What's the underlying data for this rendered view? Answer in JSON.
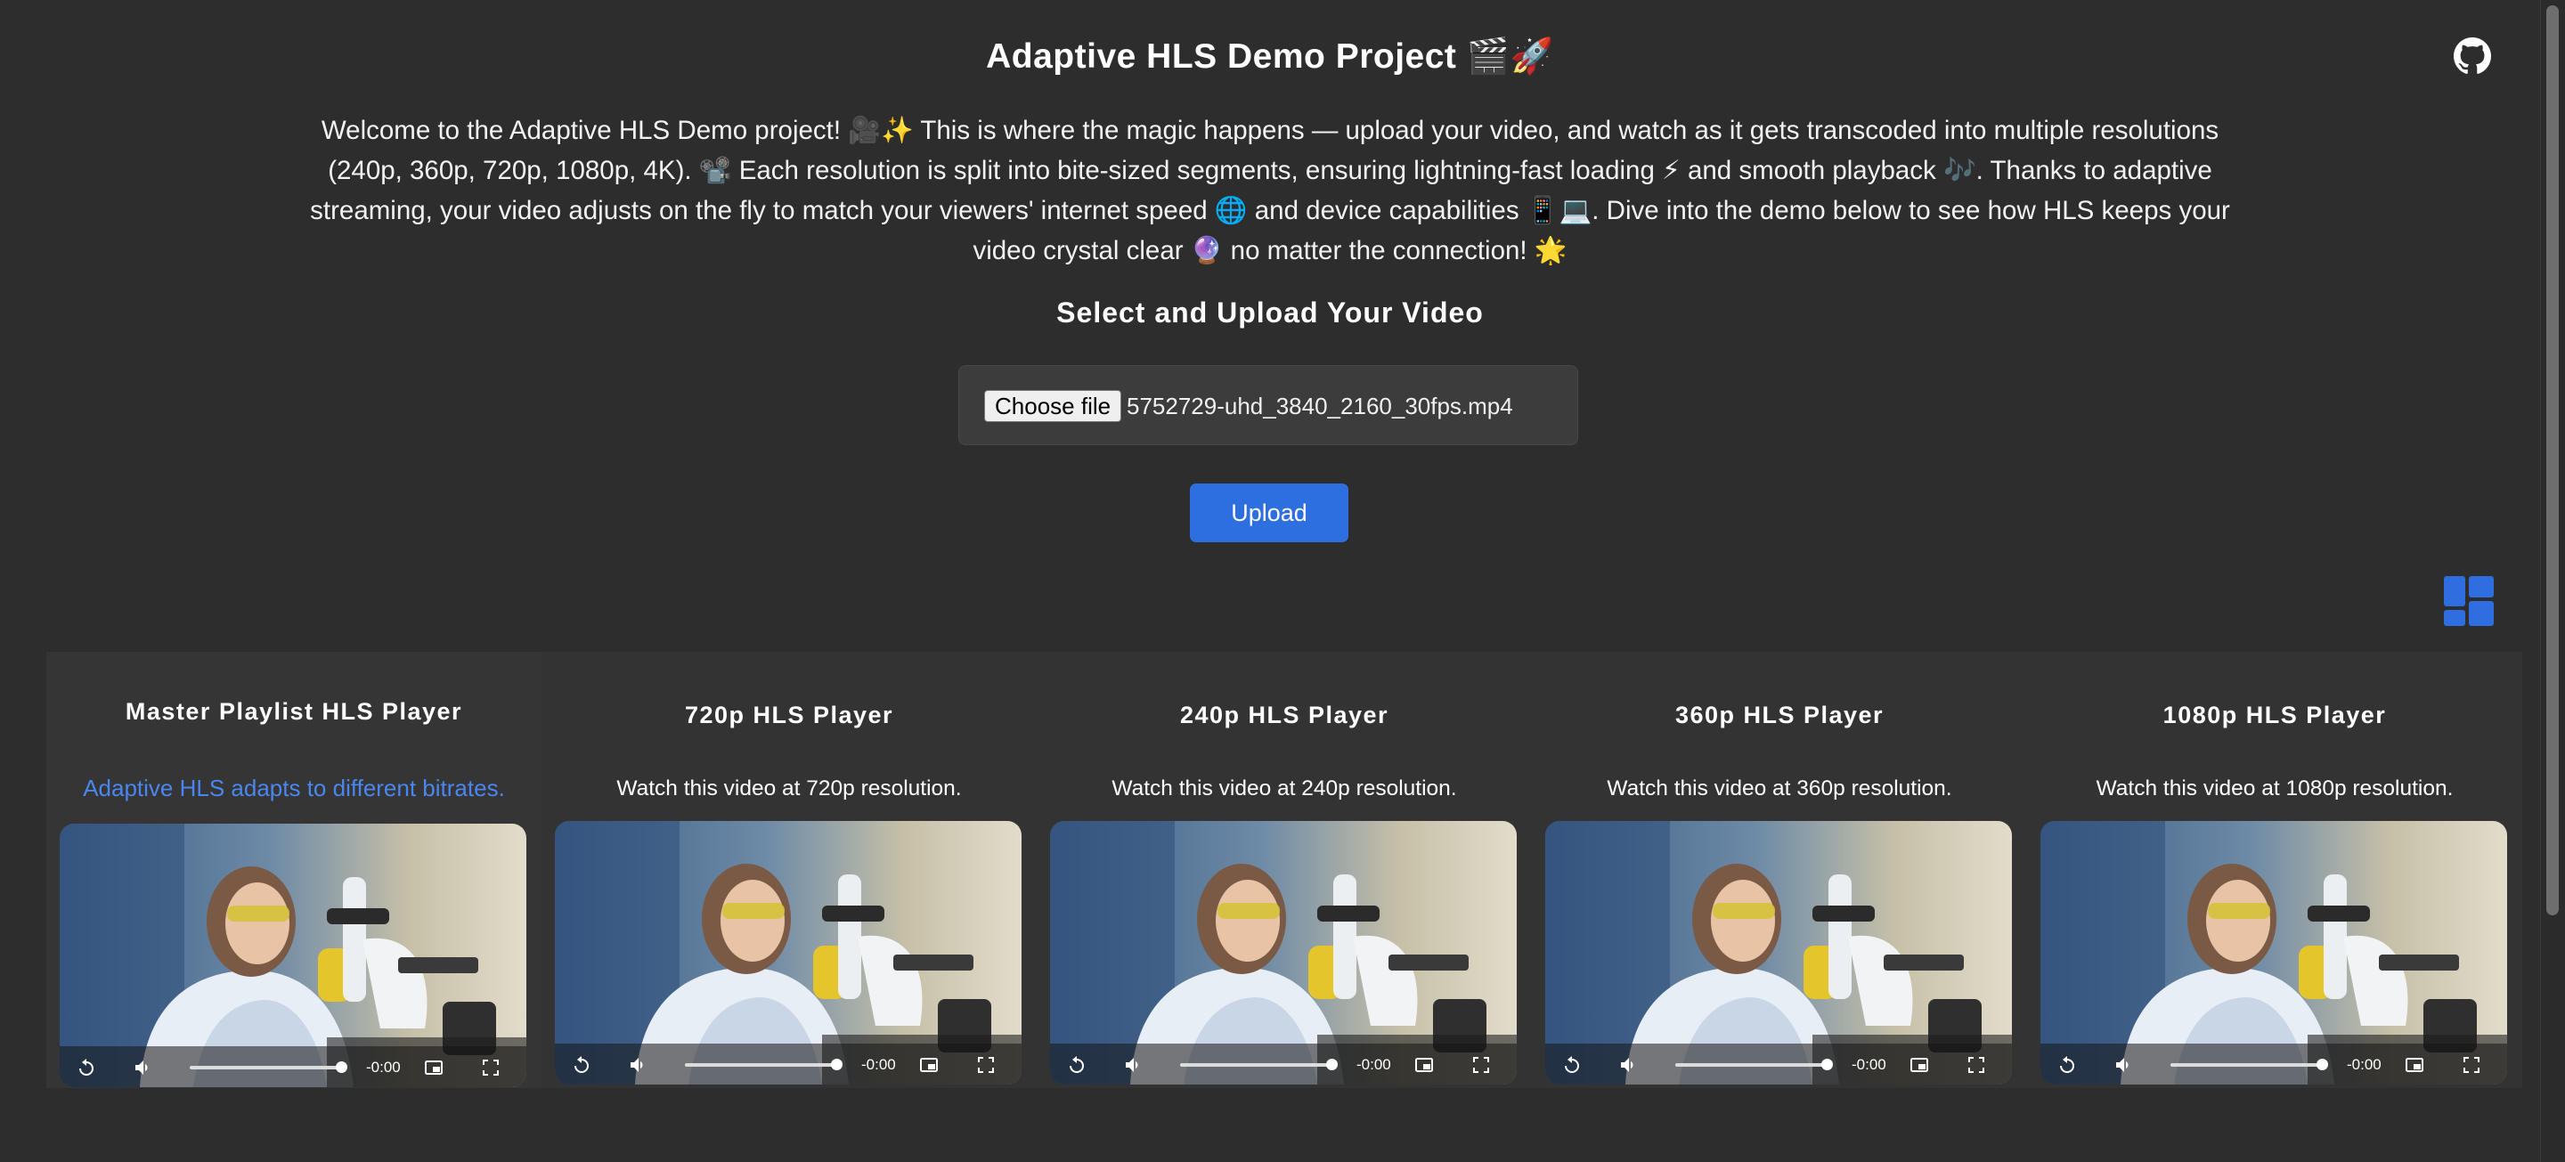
{
  "header": {
    "title": "Adaptive HLS Demo Project 🎬🚀",
    "intro": "Welcome to the Adaptive HLS Demo project! 🎥✨ This is where the magic happens — upload your video, and watch as it gets transcoded into multiple resolutions (240p, 360p, 720p, 1080p, 4K). 📽️ Each resolution is split into bite-sized segments, ensuring lightning-fast loading ⚡ and smooth playback 🎶. Thanks to adaptive streaming, your video adjusts on the fly to match your viewers' internet speed 🌐 and device capabilities 📱💻. Dive into the demo below to see how HLS keeps your video crystal clear 🔮 no matter the connection! 🌟",
    "github_icon": "github-icon"
  },
  "upload": {
    "heading": "Select and Upload Your Video",
    "choose_label": "Choose file",
    "file_name": "5752729-uhd_3840_2160_30fps.mp4",
    "upload_label": "Upload"
  },
  "layout_toggle_icon": "grid-layout-icon",
  "colors": {
    "background": "#2d2d2d",
    "accent": "#2d6fdf",
    "link": "#4a86f0"
  },
  "players": [
    {
      "title": "Master Playlist HLS Player",
      "description": "Adaptive HLS adapts to different bitrates.",
      "time": "-0:00",
      "progress": 1.0
    },
    {
      "title": "720p HLS Player",
      "description": "Watch this video at 720p resolution.",
      "time": "-0:00",
      "progress": 1.0
    },
    {
      "title": "240p HLS Player",
      "description": "Watch this video at 240p resolution.",
      "time": "-0:00",
      "progress": 1.0
    },
    {
      "title": "360p HLS Player",
      "description": "Watch this video at 360p resolution.",
      "time": "-0:00",
      "progress": 1.0
    },
    {
      "title": "1080p HLS Player",
      "description": "Watch this video at 1080p resolution.",
      "time": "-0:00",
      "progress": 1.0
    }
  ]
}
